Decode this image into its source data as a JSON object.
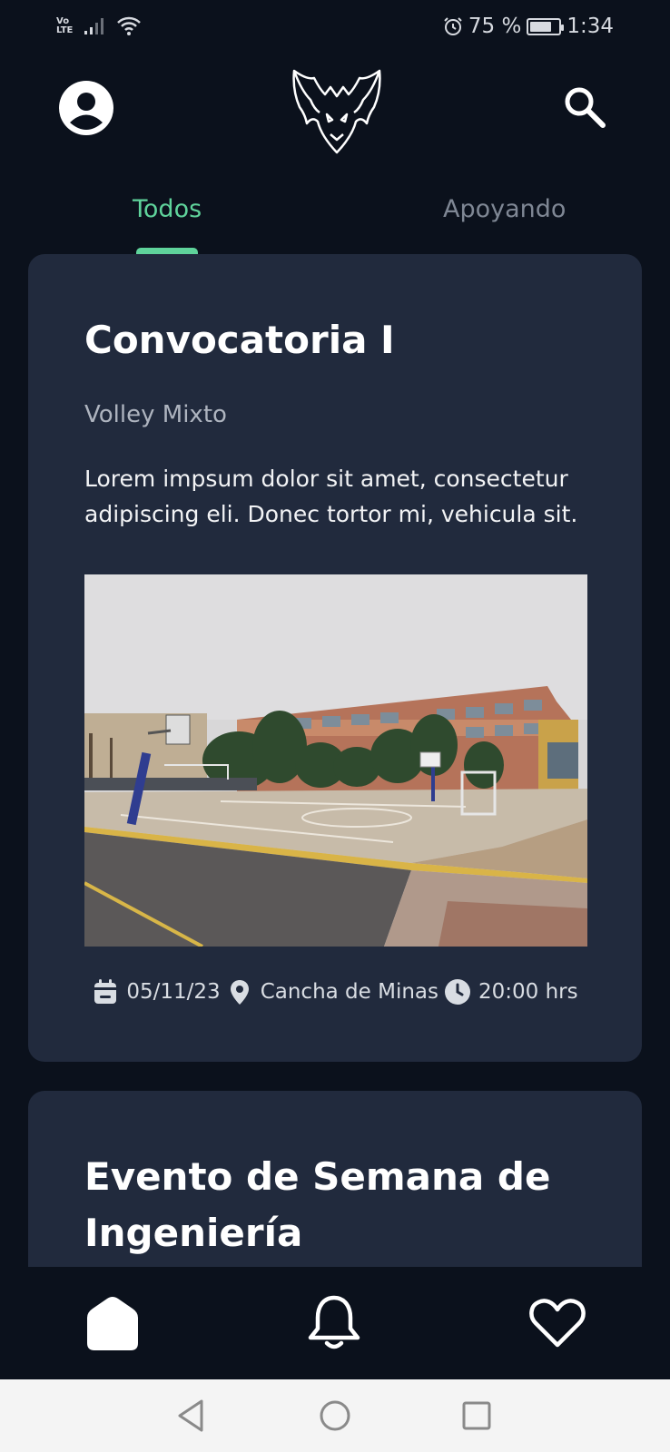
{
  "status_bar": {
    "volte_top": "Vo",
    "volte_bottom": "LTE",
    "battery_percent": "75 %",
    "battery_level": 0.75,
    "time": "1:34"
  },
  "header": {
    "avatar_icon": "account-circle-icon",
    "logo_icon": "bat-logo-icon",
    "search_icon": "search-icon"
  },
  "tabs": [
    {
      "label": "Todos",
      "active": true
    },
    {
      "label": "Apoyando",
      "active": false
    }
  ],
  "colors": {
    "accent": "#5fd39b",
    "background": "#0b111c",
    "card": "#212a3d"
  },
  "cards": [
    {
      "title": "Convocatoria I",
      "subtitle": "Volley Mixto",
      "description": "Lorem impsum dolor sit amet, consectetur adipiscing eli. Donec tortor mi, vehicula sit.",
      "image_icon": "court-photo",
      "date": "05/11/23",
      "location": "Cancha de Minas",
      "time": "20:00 hrs"
    },
    {
      "title": "Evento de Semana de Ingeniería"
    }
  ],
  "bottom_nav": [
    {
      "icon": "home-icon"
    },
    {
      "icon": "bell-icon"
    },
    {
      "icon": "heart-icon"
    }
  ]
}
